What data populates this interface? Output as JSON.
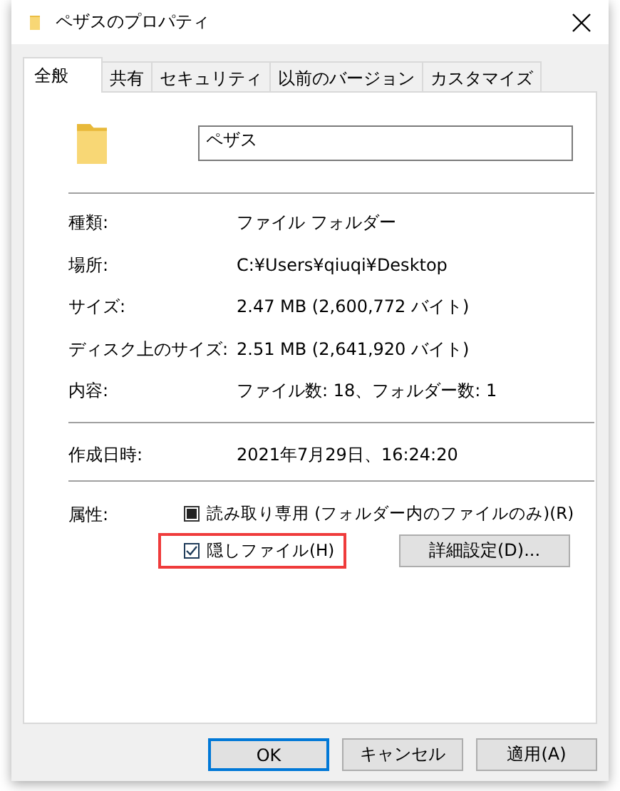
{
  "window": {
    "title": "ペザスのプロパティ"
  },
  "tabs": [
    {
      "label": "全般",
      "selected": true
    },
    {
      "label": "共有",
      "selected": false
    },
    {
      "label": "セキュリティ",
      "selected": false
    },
    {
      "label": "以前のバージョン",
      "selected": false
    },
    {
      "label": "カスタマイズ",
      "selected": false
    }
  ],
  "name_field": {
    "value": "ペザス"
  },
  "sections": [
    [
      {
        "label": "種類:",
        "value": "ファイル フォルダー"
      },
      {
        "label": "場所:",
        "value": "C:¥Users¥qiuqi¥Desktop"
      },
      {
        "label": "サイズ:",
        "value": "2.47 MB (2,600,772 バイト)"
      },
      {
        "label": "ディスク上のサイズ:",
        "value": "2.51 MB (2,641,920 バイト)"
      },
      {
        "label": "内容:",
        "value": "ファイル数: 18、フォルダー数: 1"
      }
    ],
    [
      {
        "label": "作成日時:",
        "value": "2021年7月29日、16:24:20"
      }
    ]
  ],
  "attributes": {
    "label": "属性:",
    "checkboxes": [
      {
        "label": "読み取り専用 (フォルダー内のファイルのみ)(R)",
        "checked": false,
        "indeterminate": true,
        "highlighted": false
      },
      {
        "label": "隠しファイル(H)",
        "checked": true,
        "indeterminate": false,
        "highlighted": true
      }
    ],
    "advanced_button": "詳細設定(D)..."
  },
  "buttons": [
    {
      "label": "OK",
      "default": true
    },
    {
      "label": "キャンセル",
      "default": false
    },
    {
      "label": "適用(A)",
      "default": false
    }
  ]
}
